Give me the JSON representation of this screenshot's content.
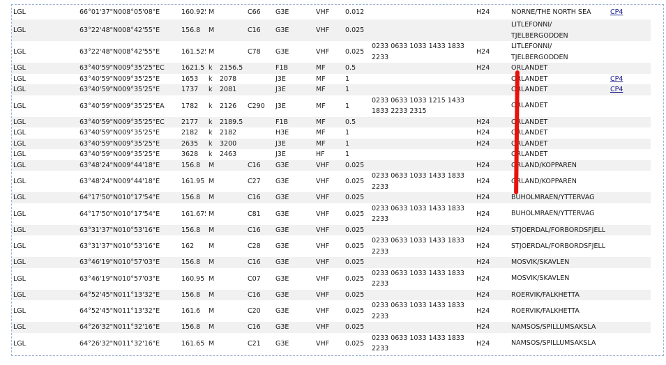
{
  "rows": [
    {
      "h": 21,
      "c": [
        "LGL",
        "",
        "66°01'37\"N008°05'08\"E",
        "160.925",
        "M",
        "",
        "C66",
        "G3E",
        "VHF",
        "0.012",
        "",
        "H24",
        "NORNE/THE NORTH SEA",
        "CP4"
      ]
    },
    {
      "h": 31,
      "c": [
        "LGL",
        "",
        "63°22'48\"N008°42'55\"E",
        "156.8",
        "M",
        "",
        "C16",
        "G3E",
        "VHF",
        "0.025",
        "",
        "",
        "LITLEFONNI/ TJELBERGODDEN",
        ""
      ]
    },
    {
      "h": 31,
      "c": [
        "LGL",
        "",
        "63°22'48\"N008°42'55\"E",
        "161.525",
        "M",
        "",
        "C78",
        "G3E",
        "VHF",
        "0.025",
        "0233 0633 1033 1433 1833 2233",
        "H24",
        "LITLEFONNI/ TJELBERGODDEN",
        ""
      ]
    },
    {
      "h": 15,
      "c": [
        "LGL",
        "",
        "63°40'59\"N009°35'25\"EC",
        "1621.5",
        "k",
        "2156.5",
        "",
        "F1B",
        "MF",
        "0.5",
        "",
        "H24",
        "ORLANDET",
        ""
      ]
    },
    {
      "h": 15,
      "c": [
        "LGL",
        "",
        "63°40'59\"N009°35'25\"E",
        "1653",
        "k",
        "2078",
        "",
        "J3E",
        "MF",
        "1",
        "",
        "",
        "ORLANDET",
        "CP4"
      ]
    },
    {
      "h": 15,
      "c": [
        "LGL",
        "",
        "63°40'59\"N009°35'25\"E",
        "1737",
        "k",
        "2081",
        "",
        "J3E",
        "MF",
        "1",
        "",
        "",
        "ORLANDET",
        "CP4"
      ]
    },
    {
      "h": 31,
      "c": [
        "LGL",
        "",
        "63°40'59\"N009°35'25\"EA",
        "1782",
        "k",
        "2126",
        "C290",
        "J3E",
        "MF",
        "1",
        "0233 0633 1033 1215 1433 1833 2233 2315",
        "",
        "ORLANDET",
        ""
      ]
    },
    {
      "h": 15,
      "c": [
        "LGL",
        "",
        "63°40'59\"N009°35'25\"EC",
        "2177",
        "k",
        "2189.5",
        "",
        "F1B",
        "MF",
        "0.5",
        "",
        "H24",
        "ORLANDET",
        ""
      ]
    },
    {
      "h": 15,
      "c": [
        "LGL",
        "",
        "63°40'59\"N009°35'25\"E",
        "2182",
        "k",
        "2182",
        "",
        "H3E",
        "MF",
        "1",
        "",
        "H24",
        "ORLANDET",
        ""
      ]
    },
    {
      "h": 15,
      "c": [
        "LGL",
        "",
        "63°40'59\"N009°35'25\"E",
        "2635",
        "k",
        "3200",
        "",
        "J3E",
        "MF",
        "1",
        "",
        "H24",
        "ORLANDET",
        ""
      ]
    },
    {
      "h": 15,
      "c": [
        "LGL",
        "",
        "63°40'59\"N009°35'25\"E",
        "3628",
        "k",
        "2463",
        "",
        "J3E",
        "HF",
        "1",
        "",
        "",
        "ORLANDET",
        ""
      ]
    },
    {
      "h": 15,
      "c": [
        "LGL",
        "",
        "63°48'24\"N009°44'18\"E",
        "156.8",
        "M",
        "",
        "C16",
        "G3E",
        "VHF",
        "0.025",
        "",
        "H24",
        "ORLAND/KOPPAREN",
        ""
      ]
    },
    {
      "h": 31,
      "c": [
        "LGL",
        "",
        "63°48'24\"N009°44'18\"E",
        "161.95",
        "M",
        "",
        "C27",
        "G3E",
        "VHF",
        "0.025",
        "0233 0633 1033 1433 1833 2233",
        "H24",
        "ORLAND/KOPPAREN",
        ""
      ]
    },
    {
      "h": 15,
      "c": [
        "LGL",
        "",
        "64°17'50\"N010°17'54\"E",
        "156.8",
        "M",
        "",
        "C16",
        "G3E",
        "VHF",
        "0.025",
        "",
        "H24",
        "BUHOLMRAEN/YTTERVAG",
        ""
      ]
    },
    {
      "h": 31,
      "c": [
        "LGL",
        "",
        "64°17'50\"N010°17'54\"E",
        "161.675",
        "M",
        "",
        "C81",
        "G3E",
        "VHF",
        "0.025",
        "0233 0633 1033 1433 1833 2233",
        "H24",
        "BUHOLMRAEN/YTTERVAG",
        ""
      ]
    },
    {
      "h": 15,
      "c": [
        "LGL",
        "",
        "63°31'37\"N010°53'16\"E",
        "156.8",
        "M",
        "",
        "C16",
        "G3E",
        "VHF",
        "0.025",
        "",
        "H24",
        "STJOERDAL/FORBORDSFJELL",
        ""
      ]
    },
    {
      "h": 31,
      "c": [
        "LGL",
        "",
        "63°31'37\"N010°53'16\"E",
        "162",
        "M",
        "",
        "C28",
        "G3E",
        "VHF",
        "0.025",
        "0233 0633 1033 1433 1833 2233",
        "H24",
        "STJOERDAL/FORBORDSFJELL",
        ""
      ]
    },
    {
      "h": 15,
      "c": [
        "LGL",
        "",
        "63°46'19\"N010°57'03\"E",
        "156.8",
        "M",
        "",
        "C16",
        "G3E",
        "VHF",
        "0.025",
        "",
        "H24",
        "MOSVIK/SKAVLEN",
        ""
      ]
    },
    {
      "h": 31,
      "c": [
        "LGL",
        "",
        "63°46'19\"N010°57'03\"E",
        "160.95",
        "M",
        "",
        "C07",
        "G3E",
        "VHF",
        "0.025",
        "0233 0633 1033 1433 1833 2233",
        "H24",
        "MOSVIK/SKAVLEN",
        ""
      ]
    },
    {
      "h": 15,
      "c": [
        "LGL",
        "",
        "64°52'45\"N011°13'32\"E",
        "156.8",
        "M",
        "",
        "C16",
        "G3E",
        "VHF",
        "0.025",
        "",
        "H24",
        "ROERVIK/FALKHETTA",
        ""
      ]
    },
    {
      "h": 31,
      "c": [
        "LGL",
        "",
        "64°52'45\"N011°13'32\"E",
        "161.6",
        "M",
        "",
        "C20",
        "G3E",
        "VHF",
        "0.025",
        "0233 0633 1033 1433 1833 2233",
        "H24",
        "ROERVIK/FALKHETTA",
        ""
      ]
    },
    {
      "h": 15,
      "c": [
        "LGL",
        "",
        "64°26'32\"N011°32'16\"E",
        "156.8",
        "M",
        "",
        "C16",
        "G3E",
        "VHF",
        "0.025",
        "",
        "H24",
        "NAMSOS/SPILLUMSAKSLA",
        ""
      ]
    },
    {
      "h": 31,
      "c": [
        "LGL",
        "",
        "64°26'32\"N011°32'16\"E",
        "161.65",
        "M",
        "",
        "C21",
        "G3E",
        "VHF",
        "0.025",
        "0233 0633 1033 1433 1833 2233",
        "H24",
        "NAMSOS/SPILLUMSAKSLA",
        ""
      ]
    }
  ]
}
